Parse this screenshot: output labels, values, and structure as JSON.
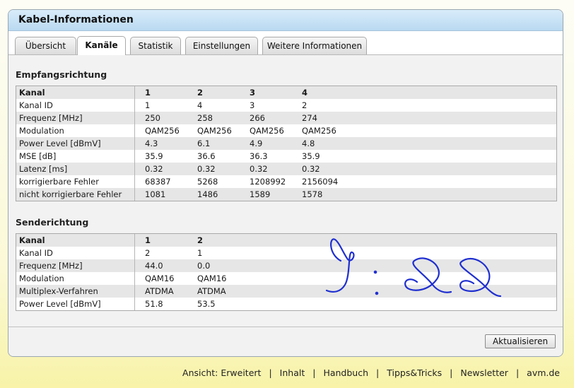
{
  "panel": {
    "title": "Kabel-Informationen"
  },
  "tabs": [
    {
      "label": "Übersicht"
    },
    {
      "label": "Kanäle"
    },
    {
      "label": "Statistik"
    },
    {
      "label": "Einstellungen"
    },
    {
      "label": "Weitere Informationen"
    }
  ],
  "downstream": {
    "title": "Empfangsrichtung",
    "rows": [
      [
        "Kanal",
        "1",
        "2",
        "3",
        "4"
      ],
      [
        "Kanal ID",
        "1",
        "4",
        "3",
        "2"
      ],
      [
        "Frequenz [MHz]",
        "250",
        "258",
        "266",
        "274"
      ],
      [
        "Modulation",
        "QAM256",
        "QAM256",
        "QAM256",
        "QAM256"
      ],
      [
        "Power Level [dBmV]",
        "4.3",
        "6.1",
        "4.9",
        "4.8"
      ],
      [
        "MSE [dB]",
        "35.9",
        "36.6",
        "36.3",
        "35.9"
      ],
      [
        "Latenz [ms]",
        "0.32",
        "0.32",
        "0.32",
        "0.32"
      ],
      [
        "korrigierbare Fehler",
        "68387",
        "5268",
        "1208992",
        "2156094"
      ],
      [
        "nicht korrigierbare Fehler",
        "1081",
        "1486",
        "1589",
        "1578"
      ]
    ]
  },
  "upstream": {
    "title": "Senderichtung",
    "rows": [
      [
        "Kanal",
        "1",
        "2"
      ],
      [
        "Kanal ID",
        "2",
        "1"
      ],
      [
        "Frequenz [MHz]",
        "44.0",
        "0.0"
      ],
      [
        "Modulation",
        "QAM16",
        "QAM16"
      ],
      [
        "Multiplex-Verfahren",
        "ATDMA",
        "ATDMA"
      ],
      [
        "Power Level [dBmV]",
        "51.8",
        "53.5"
      ]
    ]
  },
  "refresh_button": "Aktualisieren",
  "footer_nav": [
    "Ansicht: Erweitert",
    "Inhalt",
    "Handbuch",
    "Tipps&Tricks",
    "Newsletter",
    "avm.de"
  ],
  "handwriting": "9:22",
  "colors": {
    "header_bg": "#c6e0f5",
    "scribble": "#1f2fd0",
    "footer_bg": "#fbf8cf"
  }
}
